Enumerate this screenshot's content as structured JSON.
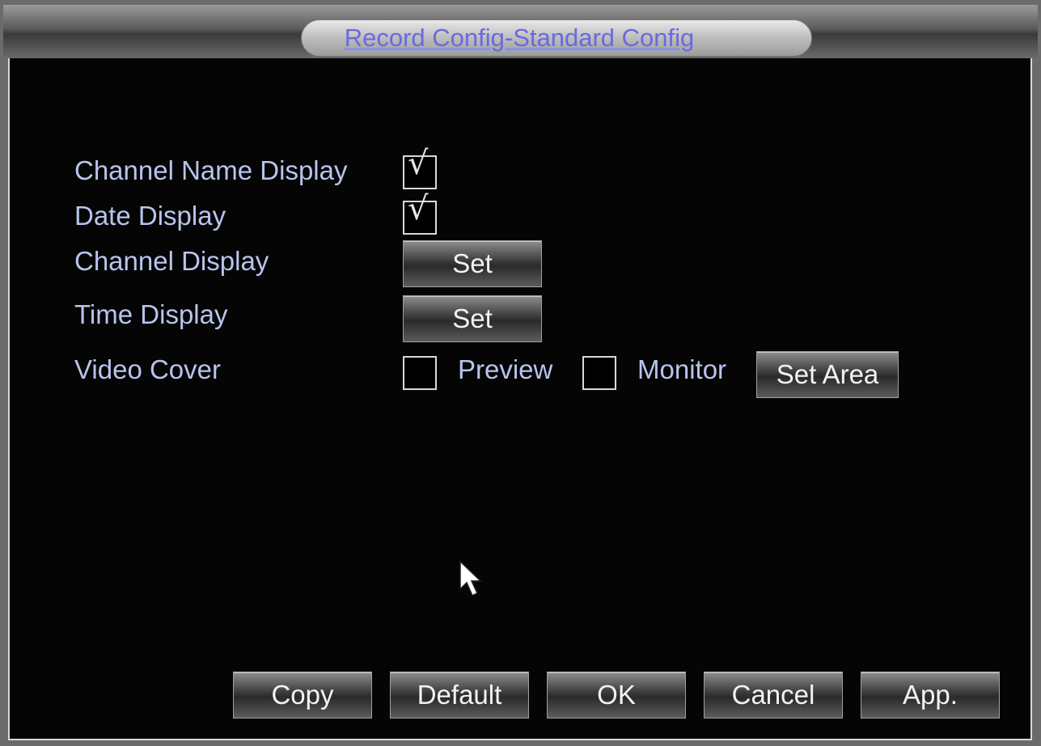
{
  "window": {
    "title": "Record Config-Standard Config"
  },
  "settings": {
    "channel_name_display": {
      "label": "Channel Name Display",
      "checked": true
    },
    "date_display": {
      "label": "Date Display",
      "checked": true
    },
    "channel_display": {
      "label": "Channel Display",
      "button": "Set"
    },
    "time_display": {
      "label": "Time Display",
      "button": "Set"
    },
    "video_cover": {
      "label": "Video Cover",
      "preview_label": "Preview",
      "preview_checked": false,
      "monitor_label": "Monitor",
      "monitor_checked": false,
      "button": "Set Area"
    }
  },
  "check_mark": "√",
  "footer": {
    "copy": "Copy",
    "default": "Default",
    "ok": "OK",
    "cancel": "Cancel",
    "apply": "App."
  },
  "colors": {
    "label": "#b8c4ec",
    "title": "#6a6ae0",
    "background": "#050505"
  }
}
